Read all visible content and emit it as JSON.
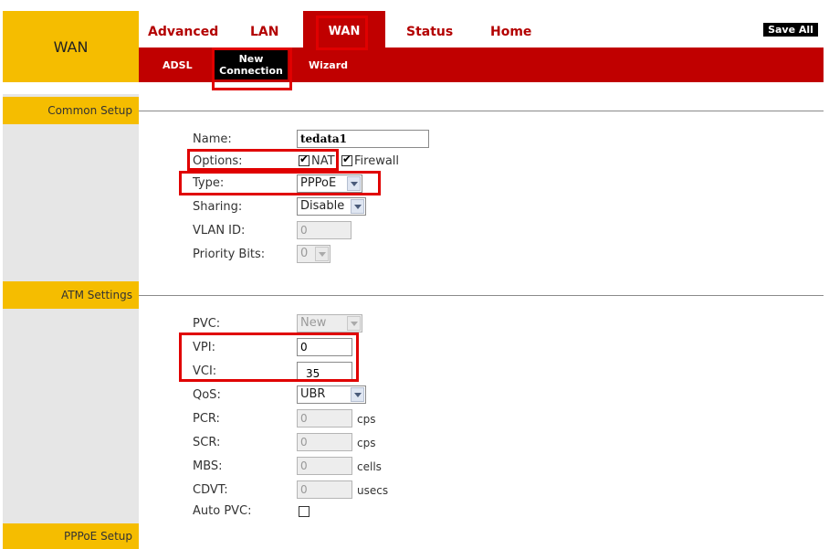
{
  "brand": {
    "title": "WAN"
  },
  "topnav": {
    "advanced": "Advanced",
    "lan": "LAN",
    "wan": "WAN",
    "status": "Status",
    "home": "Home",
    "save_all": "Save All"
  },
  "subnav": {
    "adsl": "ADSL",
    "new_connection_line1": "New",
    "new_connection_line2": "Connection",
    "wizard": "Wizard"
  },
  "sections": {
    "common_setup": "Common Setup",
    "atm_settings": "ATM Settings",
    "pppoe_setup": "PPPoE Setup"
  },
  "common": {
    "name_label": "Name:",
    "name_value": "tedata1",
    "options_label": "Options:",
    "nat_label": "NAT",
    "nat_checked": true,
    "firewall_label": "Firewall",
    "firewall_checked": true,
    "type_label": "Type:",
    "type_value": "PPPoE",
    "sharing_label": "Sharing:",
    "sharing_value": "Disable",
    "vlan_label": "VLAN ID:",
    "vlan_value": "0",
    "priority_label": "Priority Bits:",
    "priority_value": "0"
  },
  "atm": {
    "pvc_label": "PVC:",
    "pvc_value": "New",
    "vpi_label": "VPI:",
    "vpi_value": "0",
    "vci_label": "VCI:",
    "vci_value": "35",
    "qos_label": "QoS:",
    "qos_value": "UBR",
    "pcr_label": "PCR:",
    "pcr_value": "0",
    "pcr_unit": "cps",
    "scr_label": "SCR:",
    "scr_value": "0",
    "scr_unit": "cps",
    "mbs_label": "MBS:",
    "mbs_value": "0",
    "mbs_unit": "cells",
    "cdvt_label": "CDVT:",
    "cdvt_value": "0",
    "cdvt_unit": "usecs",
    "autopvc_label": "Auto PVC:",
    "autopvc_checked": false
  },
  "colors": {
    "accent_red": "#c00000",
    "brand_yellow": "#f5bd00",
    "highlight": "#e00000"
  }
}
